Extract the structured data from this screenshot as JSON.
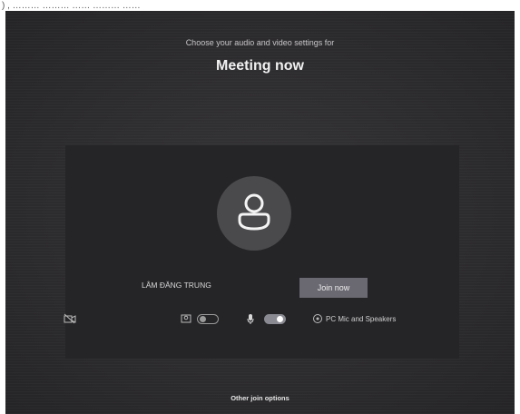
{
  "prejoin": {
    "subtitle": "Choose your audio and video settings for",
    "meeting_title": "Meeting now",
    "user_name": "LÂM ĐĂNG TRUNG",
    "join_label": "Join now"
  },
  "controls": {
    "camera_icon": "camera-off-icon",
    "background_icon": "background-effects-icon",
    "camera_toggle_on": false,
    "mic_icon": "microphone-icon",
    "mic_toggle_on": true,
    "device_icon": "pc-speaker-icon",
    "device_label": "PC Mic and Speakers"
  },
  "footer": {
    "other_options": "Other join options"
  }
}
